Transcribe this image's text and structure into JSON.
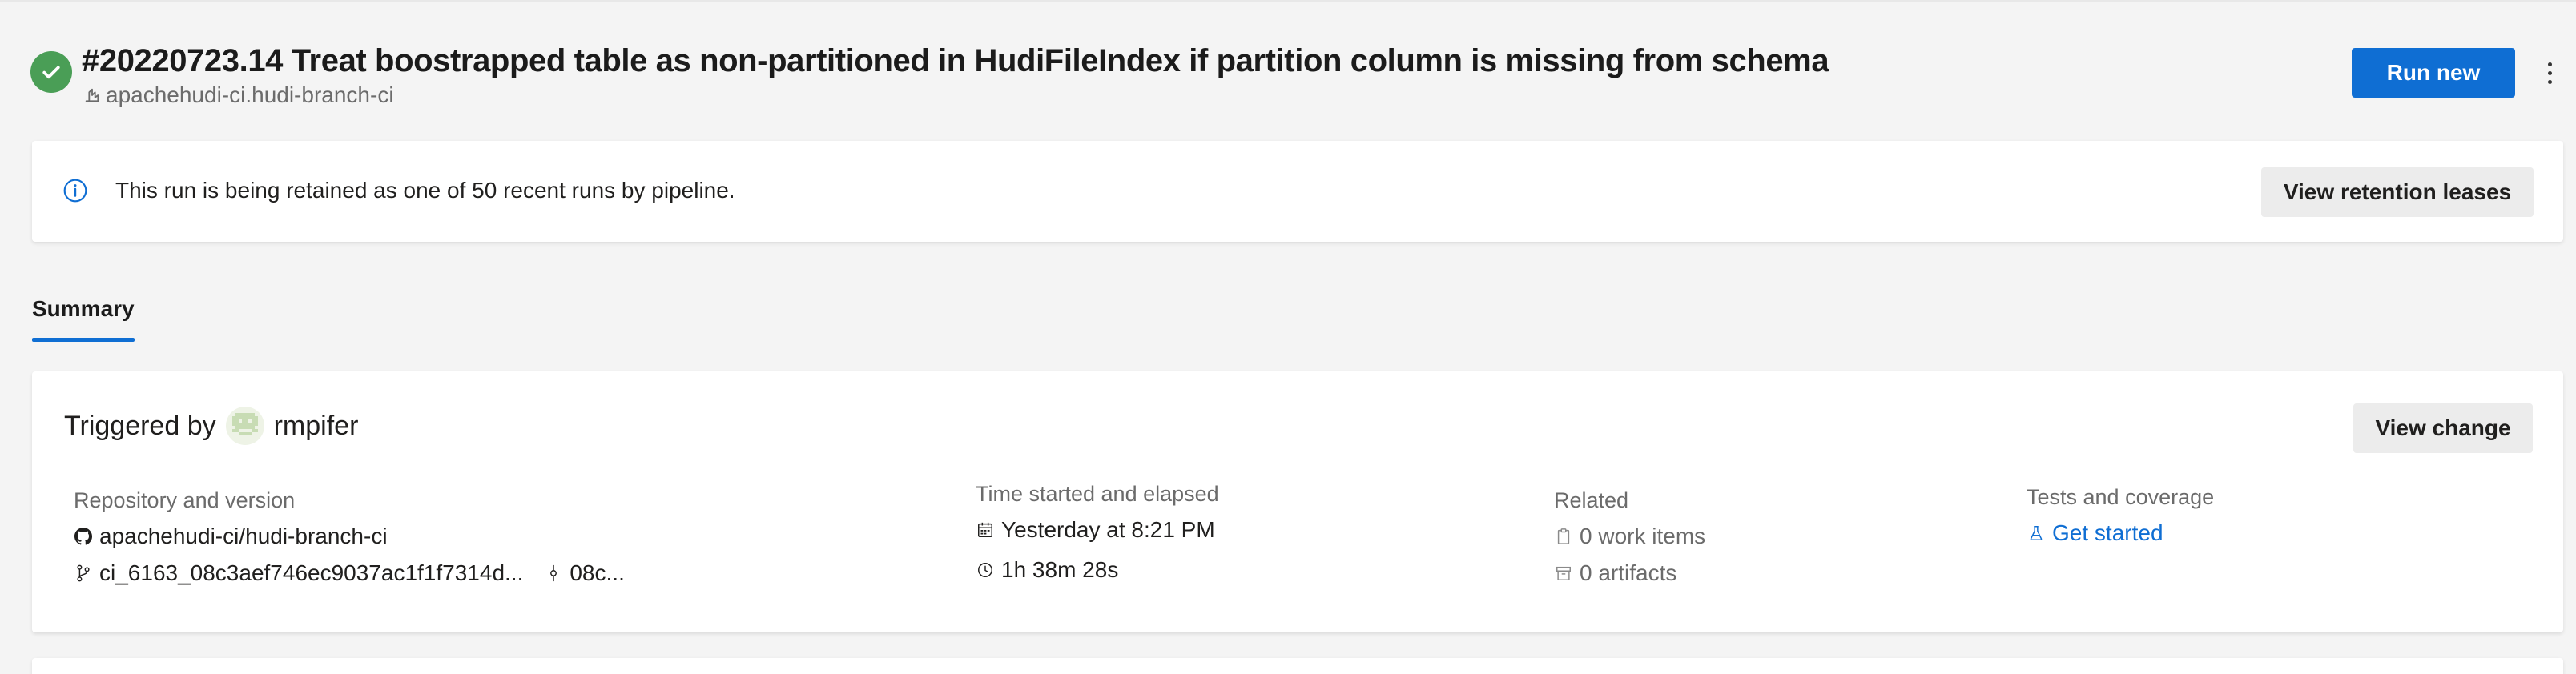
{
  "run": {
    "title": "#20220723.14 Treat boostrapped table as non-partitioned in HudiFileIndex if partition column is missing from schema",
    "pipeline": "apachehudi-ci.hudi-branch-ci",
    "status": "succeeded",
    "status_color": "#4a9e56",
    "run_new_label": "Run new"
  },
  "banner": {
    "text": "This run is being retained as one of 50 recent runs by pipeline.",
    "button_label": "View retention leases"
  },
  "tabs": [
    {
      "label": "Summary",
      "selected": true
    }
  ],
  "summary": {
    "triggered_prefix": "Triggered by",
    "triggered_user": "rmpifer",
    "view_change_label": "View change",
    "repo": {
      "label": "Repository and version",
      "name": "apachehudi-ci/hudi-branch-ci",
      "branch": "ci_6163_08c3aef746ec9037ac1f1f7314d...",
      "commit": "08c..."
    },
    "time": {
      "label": "Time started and elapsed",
      "started": "Yesterday at 8:21 PM",
      "elapsed": "1h 38m 28s"
    },
    "related": {
      "label": "Related",
      "work_items": "0 work items",
      "artifacts": "0 artifacts"
    },
    "tests": {
      "label": "Tests and coverage",
      "link": "Get started"
    }
  },
  "colors": {
    "accent": "#0f6ed3",
    "success": "#4a9e56",
    "background": "#f4f4f4"
  }
}
